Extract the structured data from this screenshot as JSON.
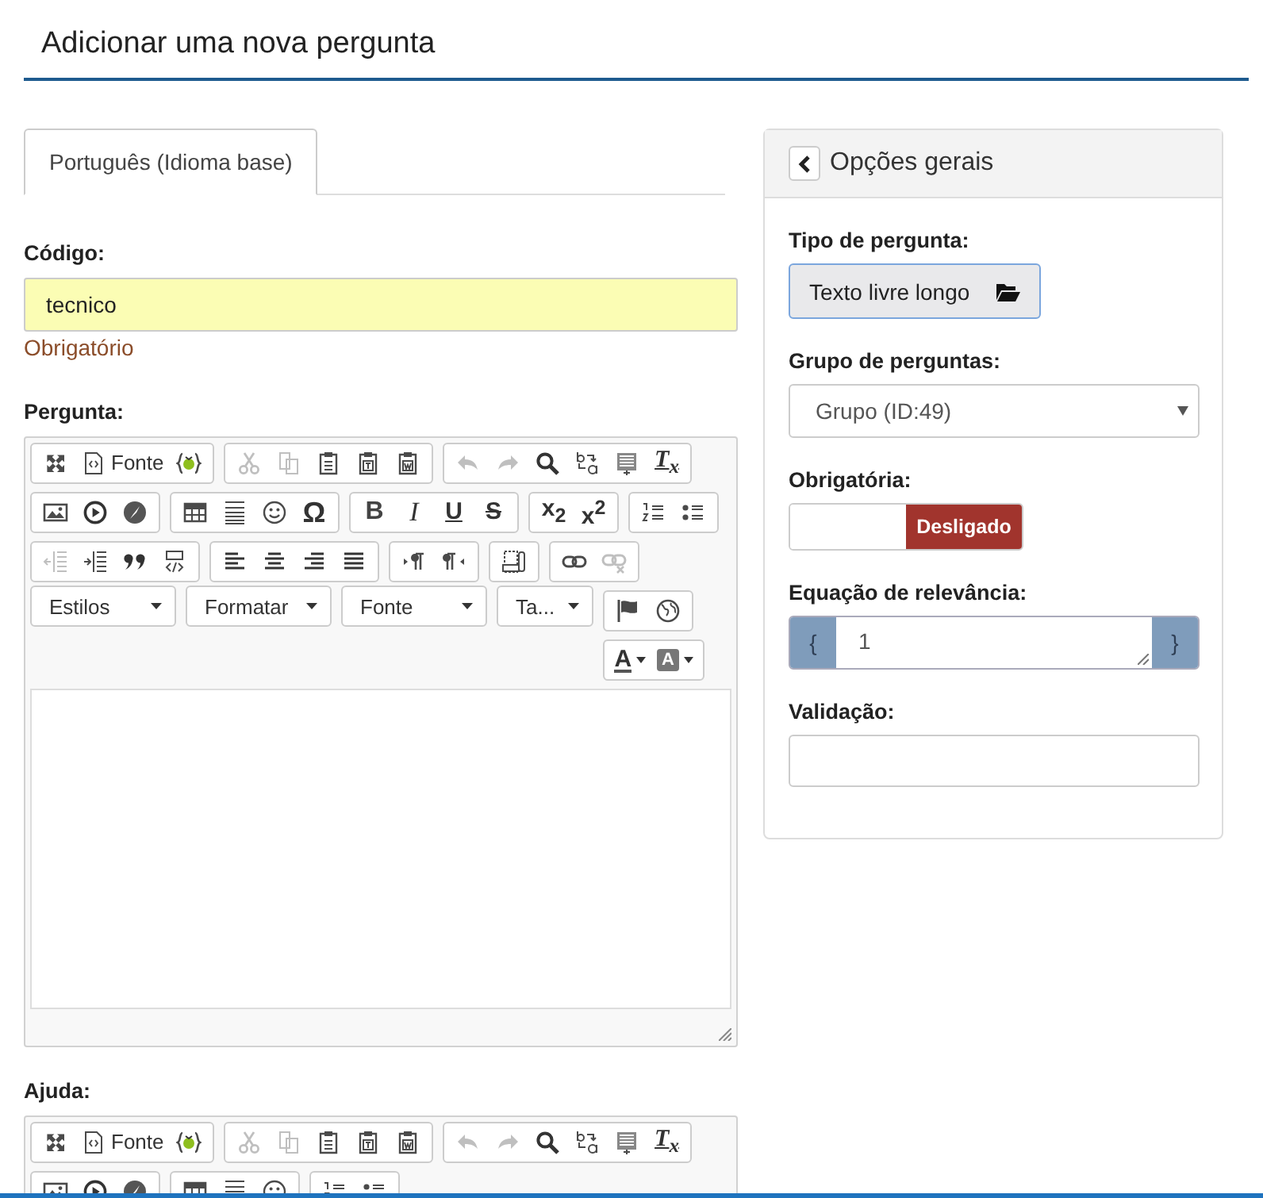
{
  "page_title": "Adicionar uma nova pergunta",
  "language_tabs": [
    {
      "label": "Português (Idioma base)",
      "selected": true
    }
  ],
  "code_field": {
    "label": "Código:",
    "value": "tecnico",
    "error": "Obrigatório"
  },
  "question": {
    "label": "Pergunta:",
    "toolbar": [
      [
        [
          {
            "kind": "maximize",
            "disabled": false
          },
          {
            "kind": "source",
            "label": "Fonte",
            "disabled": false
          },
          {
            "kind": "expression",
            "disabled": false
          }
        ],
        [
          {
            "kind": "cut",
            "disabled": true
          },
          {
            "kind": "copy",
            "disabled": true
          },
          {
            "kind": "paste",
            "disabled": false
          },
          {
            "kind": "pastetext",
            "disabled": false
          },
          {
            "kind": "pasteword",
            "disabled": false
          }
        ],
        [
          {
            "kind": "undo",
            "disabled": true
          },
          {
            "kind": "redo",
            "disabled": true
          },
          {
            "kind": "find",
            "disabled": false
          },
          {
            "kind": "replace",
            "disabled": false
          },
          {
            "kind": "selectall",
            "disabled": false
          },
          {
            "kind": "removeformat",
            "label": "T$_{x}$",
            "disabled": false
          }
        ]
      ],
      [
        [
          {
            "kind": "image",
            "disabled": false
          },
          {
            "kind": "media",
            "disabled": false
          },
          {
            "kind": "flash",
            "disabled": false
          }
        ],
        [
          {
            "kind": "table",
            "disabled": false
          },
          {
            "kind": "hr",
            "disabled": false
          },
          {
            "kind": "smiley",
            "disabled": false
          },
          {
            "kind": "specialchar",
            "label": "Ω",
            "disabled": false
          }
        ],
        [
          {
            "kind": "bold",
            "label": "B",
            "disabled": false
          },
          {
            "kind": "italic",
            "label": "I",
            "disabled": false
          },
          {
            "kind": "underline",
            "label": "U",
            "disabled": false
          },
          {
            "kind": "strike",
            "label": "S",
            "disabled": false
          }
        ],
        [
          {
            "kind": "subscript",
            "label": "x$_{2}$",
            "disabled": false
          },
          {
            "kind": "superscript",
            "label": "x$^{2}$",
            "disabled": false
          }
        ],
        [
          {
            "kind": "numberedlist",
            "disabled": false
          },
          {
            "kind": "bulletedlist",
            "disabled": false
          }
        ]
      ],
      [
        [
          {
            "kind": "outdent",
            "disabled": true
          },
          {
            "kind": "indent",
            "disabled": false
          },
          {
            "kind": "blockquote",
            "disabled": false
          },
          {
            "kind": "div",
            "disabled": false
          }
        ],
        [
          {
            "kind": "alignleft",
            "disabled": false
          },
          {
            "kind": "aligncenter",
            "disabled": false
          },
          {
            "kind": "alignright",
            "disabled": false
          },
          {
            "kind": "justify",
            "disabled": false
          }
        ],
        [
          {
            "kind": "ltr",
            "disabled": false
          },
          {
            "kind": "rtl",
            "disabled": false
          }
        ],
        [
          {
            "kind": "iframe",
            "disabled": false
          }
        ],
        [
          {
            "kind": "link",
            "disabled": false
          },
          {
            "kind": "unlink",
            "disabled": true
          }
        ]
      ],
      [
        [
          {
            "kind": "combo",
            "label": "Estilos",
            "disabled": false
          }
        ],
        [
          {
            "kind": "combo",
            "label": "Formatar",
            "disabled": false
          }
        ],
        [
          {
            "kind": "combo",
            "label": "Fonte",
            "disabled": false
          }
        ],
        [
          {
            "kind": "combo",
            "label": "Ta...",
            "disabled": false
          }
        ],
        [
          {
            "kind": "anchor",
            "disabled": false
          },
          {
            "kind": "language",
            "disabled": false
          }
        ]
      ],
      [
        [
          {
            "kind": "textcolor",
            "label": "A",
            "disabled": false
          },
          {
            "kind": "bgcolor",
            "label": "A",
            "disabled": false
          }
        ]
      ]
    ]
  },
  "help": {
    "label": "Ajuda:",
    "toolbar": [
      [
        [
          {
            "kind": "maximize",
            "disabled": false
          },
          {
            "kind": "source",
            "label": "Fonte",
            "disabled": false
          },
          {
            "kind": "expression",
            "disabled": false
          }
        ],
        [
          {
            "kind": "cut",
            "disabled": true
          },
          {
            "kind": "copy",
            "disabled": true
          },
          {
            "kind": "paste",
            "disabled": false
          },
          {
            "kind": "pastetext",
            "disabled": false
          },
          {
            "kind": "pasteword",
            "disabled": false
          }
        ],
        [
          {
            "kind": "undo",
            "disabled": true
          },
          {
            "kind": "redo",
            "disabled": true
          },
          {
            "kind": "find",
            "disabled": false
          },
          {
            "kind": "replace",
            "disabled": false
          },
          {
            "kind": "selectall",
            "disabled": false
          },
          {
            "kind": "removeformat",
            "label": "T$_{x}$",
            "disabled": false
          }
        ]
      ],
      [
        [
          {
            "kind": "image",
            "disabled": false
          },
          {
            "kind": "media",
            "disabled": false
          },
          {
            "kind": "flash",
            "disabled": false
          }
        ],
        [
          {
            "kind": "table",
            "disabled": false
          },
          {
            "kind": "hr",
            "disabled": false
          },
          {
            "kind": "smiley",
            "disabled": false
          }
        ],
        [
          {
            "kind": "numberedlist",
            "disabled": false
          },
          {
            "kind": "bulletedlist",
            "disabled": false
          }
        ]
      ]
    ]
  },
  "options_panel": {
    "title": "Opções gerais",
    "question_type": {
      "label": "Tipo de pergunta:",
      "value": "Texto livre longo"
    },
    "question_group": {
      "label": "Grupo de perguntas:",
      "value": "Grupo (ID:49)"
    },
    "mandatory": {
      "label": "Obrigatória:",
      "on": false,
      "state_label": "Desligado"
    },
    "relevance": {
      "label": "Equação de relevância:",
      "open": "{",
      "value": "1",
      "close": "}"
    },
    "validation": {
      "label": "Validação:"
    }
  }
}
